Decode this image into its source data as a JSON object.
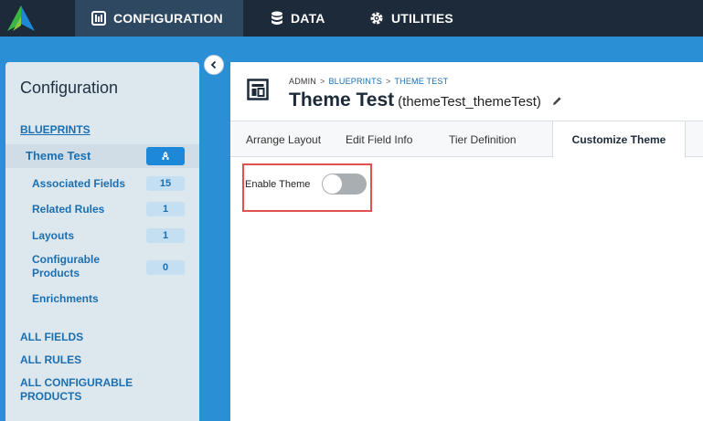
{
  "topnav": {
    "items": [
      {
        "label": "CONFIGURATION",
        "icon": "configuration-icon",
        "active": true
      },
      {
        "label": "DATA",
        "icon": "database-icon",
        "active": false
      },
      {
        "label": "UTILITIES",
        "icon": "gear-icon",
        "active": false
      }
    ]
  },
  "sidebar": {
    "title": "Configuration",
    "blueprints_label": "BLUEPRINTS",
    "blueprint_name": "Theme Test",
    "sub_items": [
      {
        "label": "Associated Fields",
        "count": "15"
      },
      {
        "label": "Related Rules",
        "count": "1"
      },
      {
        "label": "Layouts",
        "count": "1"
      },
      {
        "label": "Configurable Products",
        "count": "0"
      },
      {
        "label": "Enrichments"
      }
    ],
    "links": [
      "ALL FIELDS",
      "ALL RULES",
      "ALL CONFIGURABLE PRODUCTS"
    ]
  },
  "breadcrumb": [
    "ADMIN",
    "BLUEPRINTS",
    "THEME TEST"
  ],
  "page": {
    "title": "Theme Test",
    "subtitle": "(themeTest_themeTest)"
  },
  "tabs": [
    {
      "label": "Arrange Layout",
      "active": false
    },
    {
      "label": "Edit Field Info",
      "active": false
    },
    {
      "label": "Tier Definition",
      "active": false
    },
    {
      "label": "Customize Theme",
      "active": true
    }
  ],
  "theme": {
    "enable_label": "Enable Theme",
    "enabled": false
  },
  "colors": {
    "topbar": "#1c2a3a",
    "accent": "#2b8fd6",
    "link": "#1b6fb0",
    "highlight": "#e05252"
  }
}
